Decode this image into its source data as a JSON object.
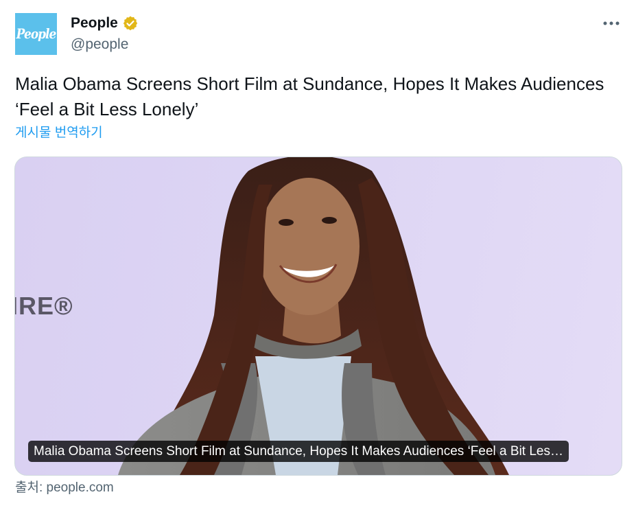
{
  "author": {
    "avatar_text": "People",
    "display_name": "People",
    "handle": "@people",
    "verified_badge": "gold-verified-icon"
  },
  "more_icon": "more-horizontal-icon",
  "tweet": {
    "text": "Malia Obama Screens Short Film at Sundance, Hopes It Makes Audiences ‘Feel a Bit Less Lonely’",
    "translate_label": "게시물 번역하기"
  },
  "card": {
    "backdrop_text": "IRE®",
    "caption": "Malia Obama Screens Short Film at Sundance, Hopes It Makes Audiences ‘Feel a Bit Les…"
  },
  "source": {
    "label": "출처: people.com"
  },
  "colors": {
    "avatar_bg": "#5bc0eb",
    "link": "#1d9bf0",
    "verified_gold": "#e2b719",
    "secondary_text": "#536471"
  }
}
